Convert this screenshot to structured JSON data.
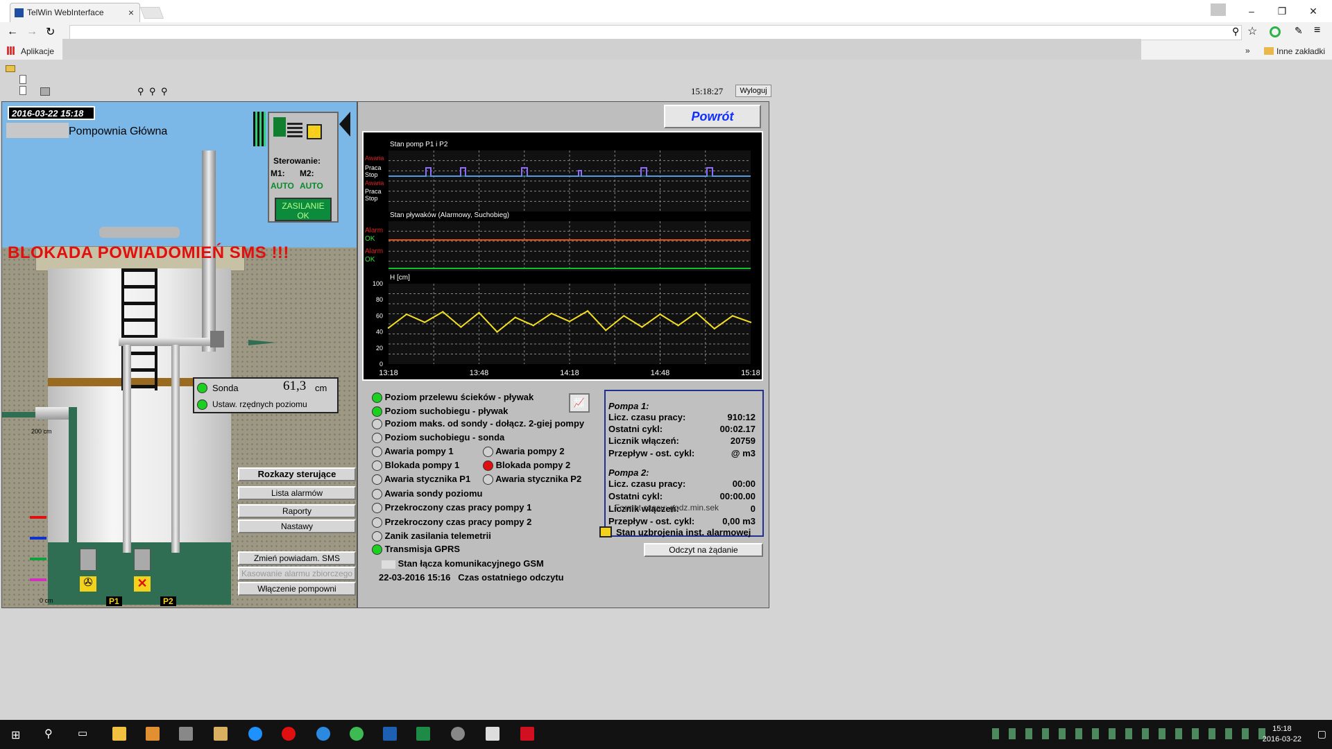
{
  "browser": {
    "tab_title": "TelWin WebInterface",
    "bookmarks_apps": "Aplikacje",
    "other_bookmarks": "Inne zakładki",
    "chevron": "»"
  },
  "toolbar": {
    "time": "15:18:27",
    "logout": "Wyloguj"
  },
  "scada": {
    "datetime": "2016-03-22 15:18",
    "station": "Pompownia Główna",
    "sms_block": "BLOKADA POWIADOMIEŃ SMS !!!",
    "control": {
      "label": "Sterowanie:",
      "m1": "M1:",
      "m2": "M2:",
      "m1_mode": "AUTO",
      "m2_mode": "AUTO",
      "power": "ZASILANIE OK"
    },
    "sonda": {
      "label": "Sonda",
      "value": "61,3",
      "unit": "cm",
      "ordinate": "Ustaw. rzędnych poziomu"
    },
    "depth_top": "200 cm",
    "depth_bottom": "0 cm",
    "pump_labels": [
      "P1",
      "P2"
    ],
    "buttons": [
      "Rozkazy sterujące",
      "Lista alarmów",
      "Raporty",
      "Nastawy",
      "Zmień powiadam. SMS",
      "Kasowanie alarmu zbiorczego",
      "Włączenie pompowni"
    ]
  },
  "right": {
    "back": "Powrót",
    "chart_titles": [
      "Stan pomp P1 i P2",
      "Stan pływaków (Alarmowy, Suchobieg)",
      "H [cm]"
    ],
    "pump_axis": [
      "Awaria",
      "Praca",
      "Stop",
      "Awaria",
      "Praca",
      "Stop"
    ],
    "float_axis": [
      "Alarm",
      "OK",
      "Alarm",
      "OK"
    ],
    "alarms": [
      {
        "label": "Poziom przelewu ścieków - pływak",
        "state": "on"
      },
      {
        "label": "Poziom suchobiegu - pływak",
        "state": "on"
      },
      {
        "label": "Poziom maks. od sondy - dołącz. 2-giej pompy",
        "state": "off"
      },
      {
        "label": "Poziom suchobiegu - sonda",
        "state": "off"
      },
      {
        "label": "Awaria pompy 1",
        "state": "off"
      },
      {
        "label": "Blokada pompy 1",
        "state": "off"
      },
      {
        "label": "Awaria stycznika P1",
        "state": "off"
      },
      {
        "label": "Awaria sondy poziomu",
        "state": "off"
      },
      {
        "label": "Przekroczony czas pracy pompy 1",
        "state": "off"
      },
      {
        "label": "Przekroczony czas pracy pompy 2",
        "state": "off"
      },
      {
        "label": "Zanik zasilania telemetrii",
        "state": "off"
      },
      {
        "label": "Transmisja GPRS",
        "state": "on"
      }
    ],
    "alarms_col2": [
      {
        "label": "Awaria pompy 2",
        "state": "off"
      },
      {
        "label": "Blokada pompy 2",
        "state": "red"
      },
      {
        "label": "Awaria stycznika P2",
        "state": "off"
      }
    ],
    "gsm": "Stan łącza komunikacyjnego GSM",
    "last_read_time": "22-03-2016 15:16",
    "last_read_label": "Czas ostatniego odczytu",
    "pump1_title": "Pompa 1:",
    "pump2_title": "Pompa 2:",
    "pump1": [
      [
        "Licz. czasu pracy:",
        "910:12"
      ],
      [
        "Ostatni cykl:",
        "00:02.17"
      ],
      [
        "Licznik włączeń:",
        "20759"
      ],
      [
        "Przepływ - ost. cykl:",
        "@ m3"
      ]
    ],
    "pump2": [
      [
        "Licz. czasu pracy:",
        "00:00"
      ],
      [
        "Ostatni cykl:",
        "00:00.00"
      ],
      [
        "Licznik włączeń:",
        "0"
      ],
      [
        "Przepływ - ost. cykl:",
        "0,00 m3"
      ]
    ],
    "time_format": "Format czasu: godz.min.sek",
    "alarm_arm": "Stan uzbrojenia inst. alarmowej",
    "read_btn": "Odczyt na żądanie"
  },
  "chart_data": {
    "type": "line",
    "title": "H [cm]",
    "x": [
      "13:18",
      "13:48",
      "14:18",
      "14:48",
      "15:18"
    ],
    "ylim": [
      0,
      100
    ],
    "yticks": [
      0,
      20,
      40,
      60,
      80,
      100
    ],
    "series": [
      {
        "values": [
          45,
          62,
          52,
          65,
          46,
          64,
          40,
          58,
          48,
          63,
          53,
          66,
          42,
          60,
          46,
          62,
          48,
          64,
          44,
          60,
          52
        ]
      }
    ]
  },
  "taskbar": {
    "time": "15:18",
    "date": "2016-03-22"
  }
}
